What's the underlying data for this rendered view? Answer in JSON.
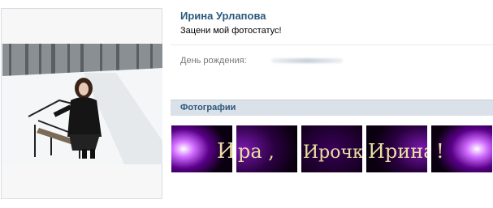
{
  "profile": {
    "name": "Ирина Урлапова",
    "status": "Зацени мой фотостатус!"
  },
  "info": {
    "birthday_label": "День рождения:"
  },
  "photos": {
    "section_title": "Фотографии",
    "thumbs": [
      {
        "text": "И"
      },
      {
        "text": "ра ,"
      },
      {
        "text": "Ирочка ,"
      },
      {
        "text": "Ирина"
      },
      {
        "text": "!"
      }
    ]
  },
  "colors": {
    "link": "#2b587a",
    "section_bg": "#dae1e8",
    "photostatus_glow": "#b000ff",
    "photostatus_text": "#e8e0a0"
  }
}
